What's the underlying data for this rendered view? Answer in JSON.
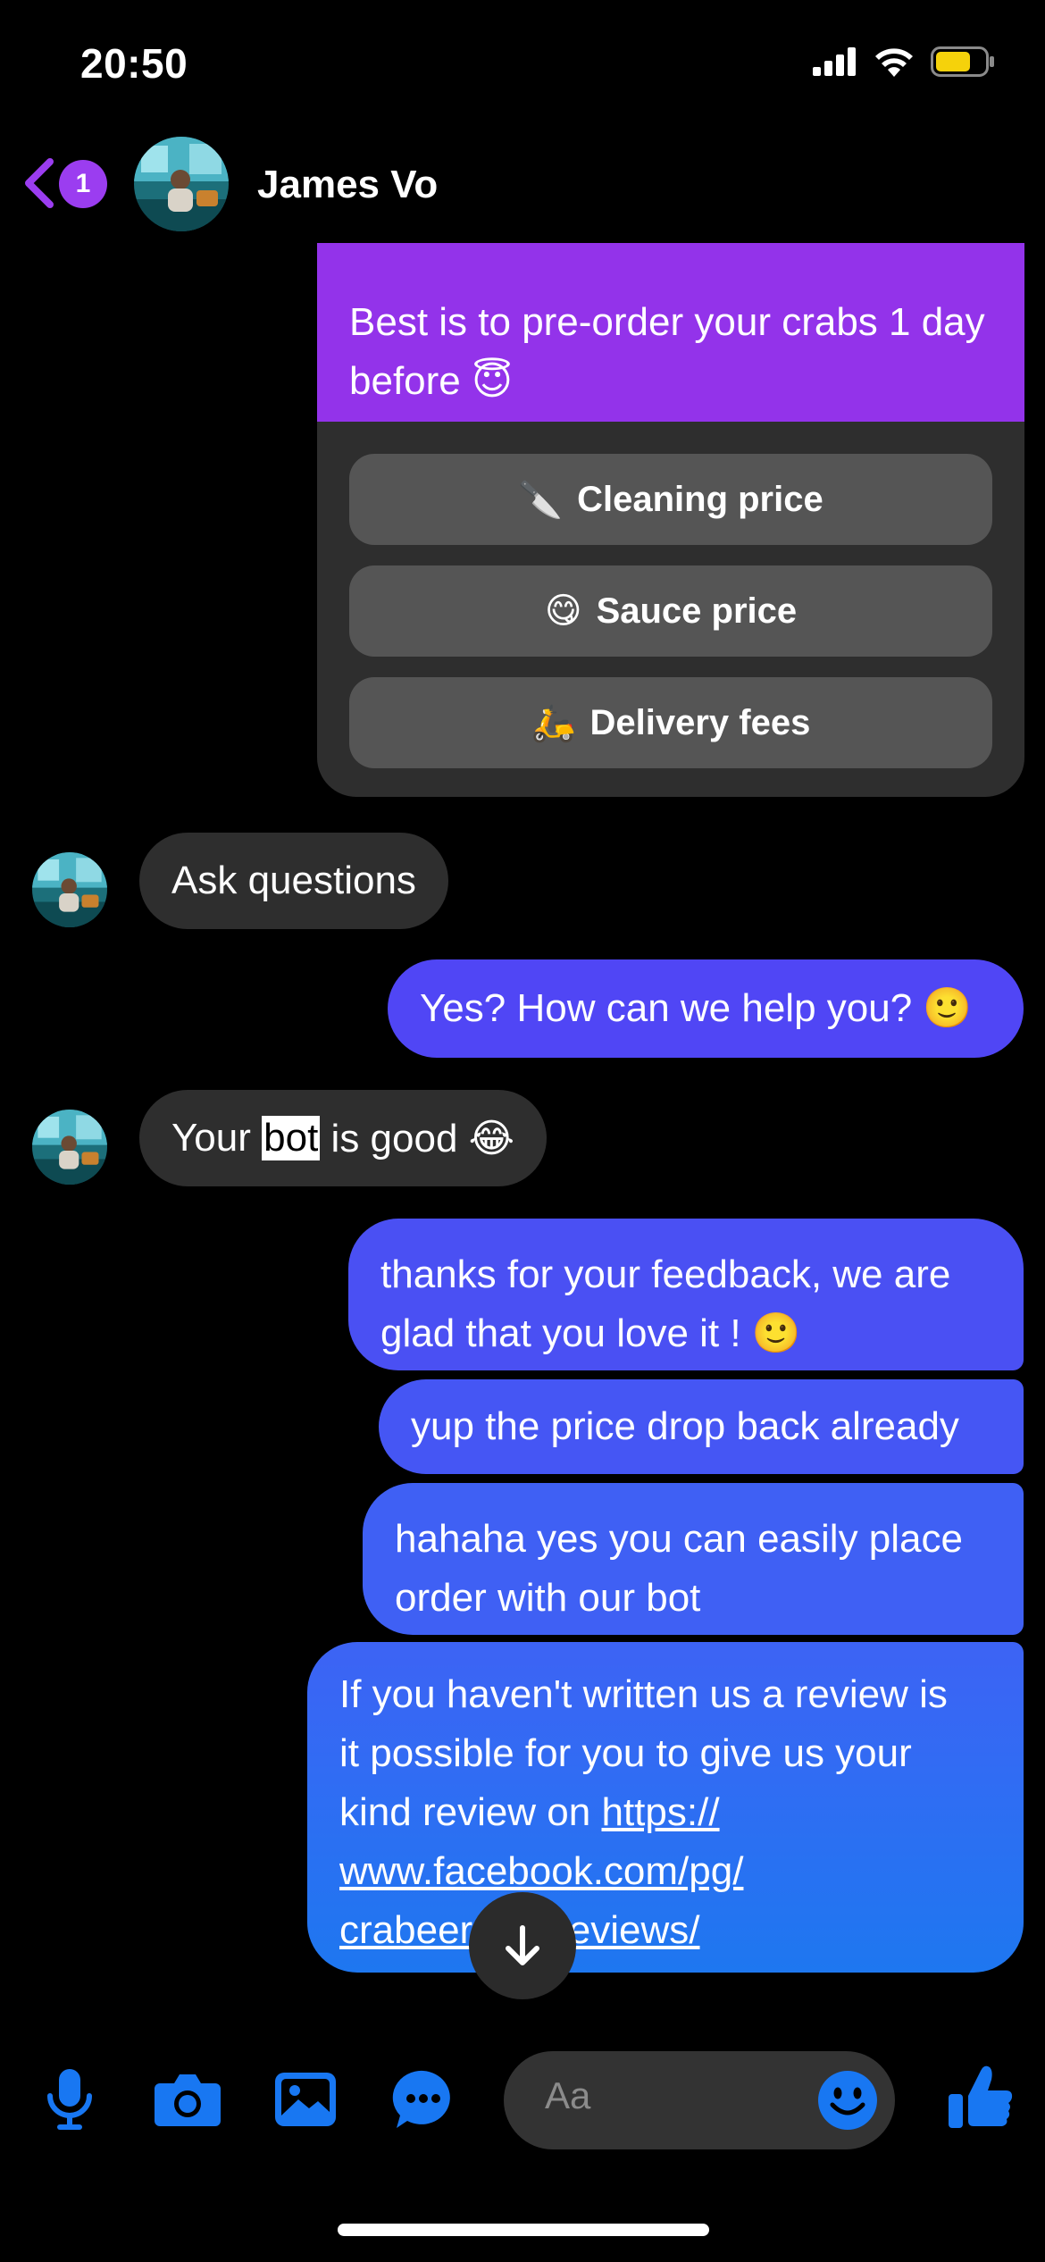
{
  "status": {
    "time": "20:50"
  },
  "header": {
    "unread_count": "1",
    "contact_name": "James Vo"
  },
  "bot_card": {
    "message": "Best is to pre-order your crabs 1 day before 😇",
    "quick_replies": [
      {
        "emoji": "🔪",
        "label": "Cleaning price"
      },
      {
        "emoji": "😋",
        "label": "Sauce price"
      },
      {
        "emoji": "🛵",
        "label": "Delivery fees"
      }
    ]
  },
  "messages": {
    "in_1": "Ask questions",
    "out_1": "Yes? How can we help you? 🙂",
    "in_2_a": "Your ",
    "in_2_b": "bot",
    "in_2_c": " is good 😂",
    "out_2_l1": "thanks for your feedback, we are",
    "out_2_l2": "glad that you love it ! 🙂",
    "out_3": "yup the price drop back already",
    "out_4_l1": "hahaha yes you can easily place",
    "out_4_l2": "order with our bot",
    "out_5_l1": "If you haven't written us a review is",
    "out_5_l2": "it possible for you to give us your",
    "out_5_l3": "kind review on ",
    "out_5_link1": "https://",
    "out_5_link2": "www.facebook.com/pg/",
    "out_5_link3": "crabeerasia/reviews/"
  },
  "composer": {
    "placeholder": "Aa"
  },
  "icons": [
    "back-chevron-icon",
    "signal-icon",
    "wifi-icon",
    "battery-icon",
    "microphone-icon",
    "camera-icon",
    "gallery-icon",
    "chat-apps-icon",
    "emoji-icon",
    "thumbs-up-icon",
    "arrow-down-icon"
  ],
  "colors": {
    "accent_purple": "#9333ea",
    "bubble_gray": "#2e2e2e",
    "messenger_blue": "#1877f2",
    "battery_yellow": "#f5d20b"
  }
}
